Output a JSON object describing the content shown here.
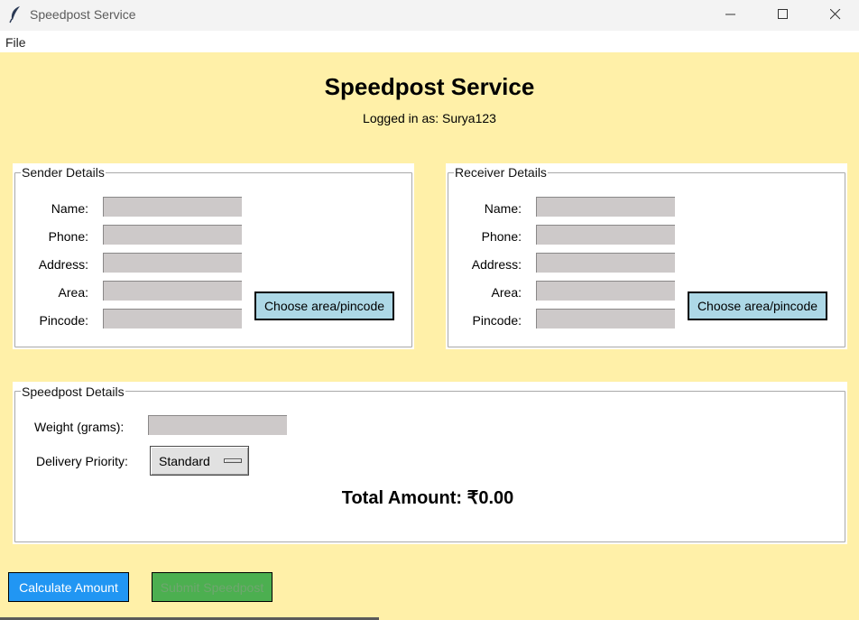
{
  "window": {
    "title": "Speedpost Service",
    "icon": "feather-icon"
  },
  "menu": {
    "file_label": "File"
  },
  "header": {
    "title": "Speedpost Service",
    "logged_in": "Logged in as: Surya123"
  },
  "sender": {
    "legend": "Sender Details",
    "labels": {
      "name": "Name:",
      "phone": "Phone:",
      "address": "Address:",
      "area": "Area:",
      "pincode": "Pincode:"
    },
    "values": {
      "name": "",
      "phone": "",
      "address": "",
      "area": "",
      "pincode": ""
    },
    "choose_label": "Choose area/pincode"
  },
  "receiver": {
    "legend": "Receiver Details",
    "labels": {
      "name": "Name:",
      "phone": "Phone:",
      "address": "Address:",
      "area": "Area:",
      "pincode": "Pincode:"
    },
    "values": {
      "name": "",
      "phone": "",
      "address": "",
      "area": "",
      "pincode": ""
    },
    "choose_label": "Choose area/pincode"
  },
  "speedpost": {
    "legend": "Speedpost Details",
    "weight_label": "Weight (grams):",
    "weight_value": "",
    "priority_label": "Delivery Priority:",
    "priority_value": "Standard",
    "total_label": "Total Amount: ₹0.00"
  },
  "actions": {
    "calculate_label": "Calculate Amount",
    "submit_label": "Submit Speedpost"
  },
  "colors": {
    "background": "#fff0a8",
    "input_fill": "#cdc9c9",
    "choose_button": "#add8e6",
    "calculate_button": "#2196f3",
    "submit_button": "#4caf50"
  }
}
